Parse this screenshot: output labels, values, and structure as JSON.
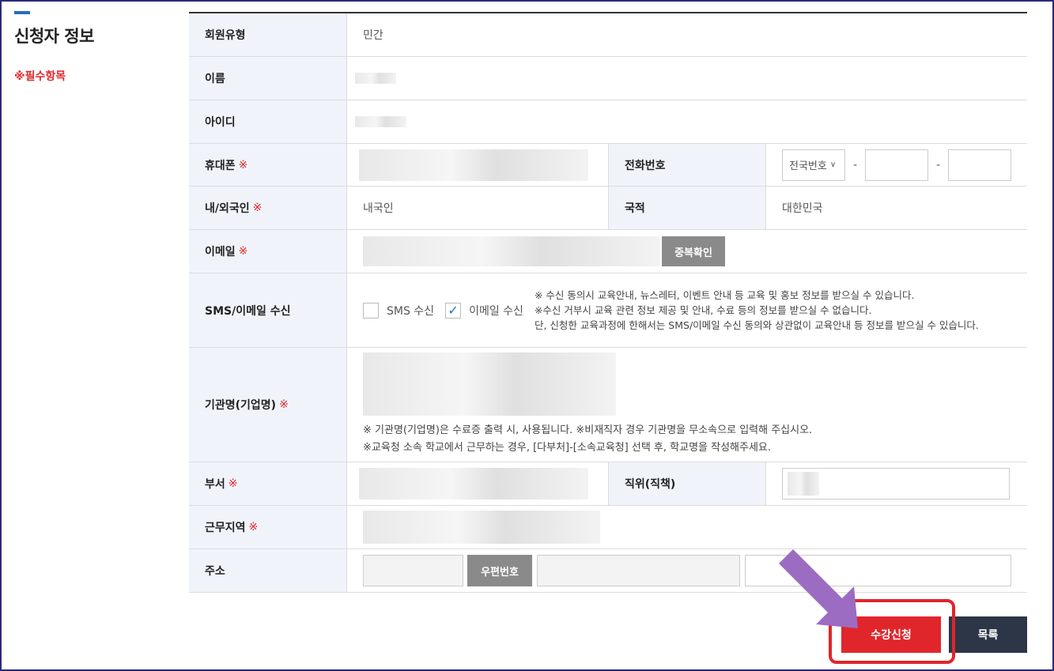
{
  "sidebar": {
    "title": "신청자 정보",
    "required_note": "※필수항목"
  },
  "form": {
    "member_type": {
      "label": "회원유형",
      "value": "민간"
    },
    "name": {
      "label": "이름"
    },
    "id": {
      "label": "아이디"
    },
    "mobile": {
      "label": "휴대폰",
      "mark": "※"
    },
    "phone": {
      "label": "전화번호",
      "area_select": "전국번호",
      "dash": "-"
    },
    "nationality_type": {
      "label": "내/외국인",
      "mark": "※",
      "value": "내국인"
    },
    "country": {
      "label": "국적",
      "value": "대한민국"
    },
    "email": {
      "label": "이메일",
      "mark": "※",
      "dup_check": "중복확인"
    },
    "consent": {
      "label": "SMS/이메일 수신",
      "sms": "SMS 수신",
      "email": "이메일 수신",
      "notes": [
        "※ 수신 동의시 교육안내, 뉴스레터, 이벤트 안내 등 교육 및 홍보 정보를 받으실 수 있습니다.",
        "※수신 거부시 교육 관련 정보 제공 및 안내, 수료 등의 정보를 받으실 수 없습니다.",
        "단, 신청한 교육과정에 한해서는 SMS/이메일 수신 동의와 상관없이 교육안내 등 정보를 받으실 수 있습니다."
      ]
    },
    "org": {
      "label": "기관명(기업명)",
      "mark": "※",
      "notes": [
        "※ 기관명(기업명)은 수료증 출력 시, 사용됩니다. ※비재직자 경우 기관명을 무소속으로 입력해 주십시오.",
        "※교육청 소속 학교에서 근무하는 경우, [다부처]-[소속교육청] 선택 후, 학교명을 작성해주세요."
      ]
    },
    "dept": {
      "label": "부서",
      "mark": "※"
    },
    "position": {
      "label": "직위(직책)"
    },
    "region": {
      "label": "근무지역",
      "mark": "※"
    },
    "address": {
      "label": "주소",
      "zip_button": "우편번호"
    }
  },
  "actions": {
    "apply": "수강신청",
    "list": "목록"
  },
  "colors": {
    "accent": "#1f6fc4",
    "required": "#e0262b",
    "apply_button": "#e0262b",
    "list_button": "#2d3647",
    "arrow": "#9b6cc2"
  }
}
